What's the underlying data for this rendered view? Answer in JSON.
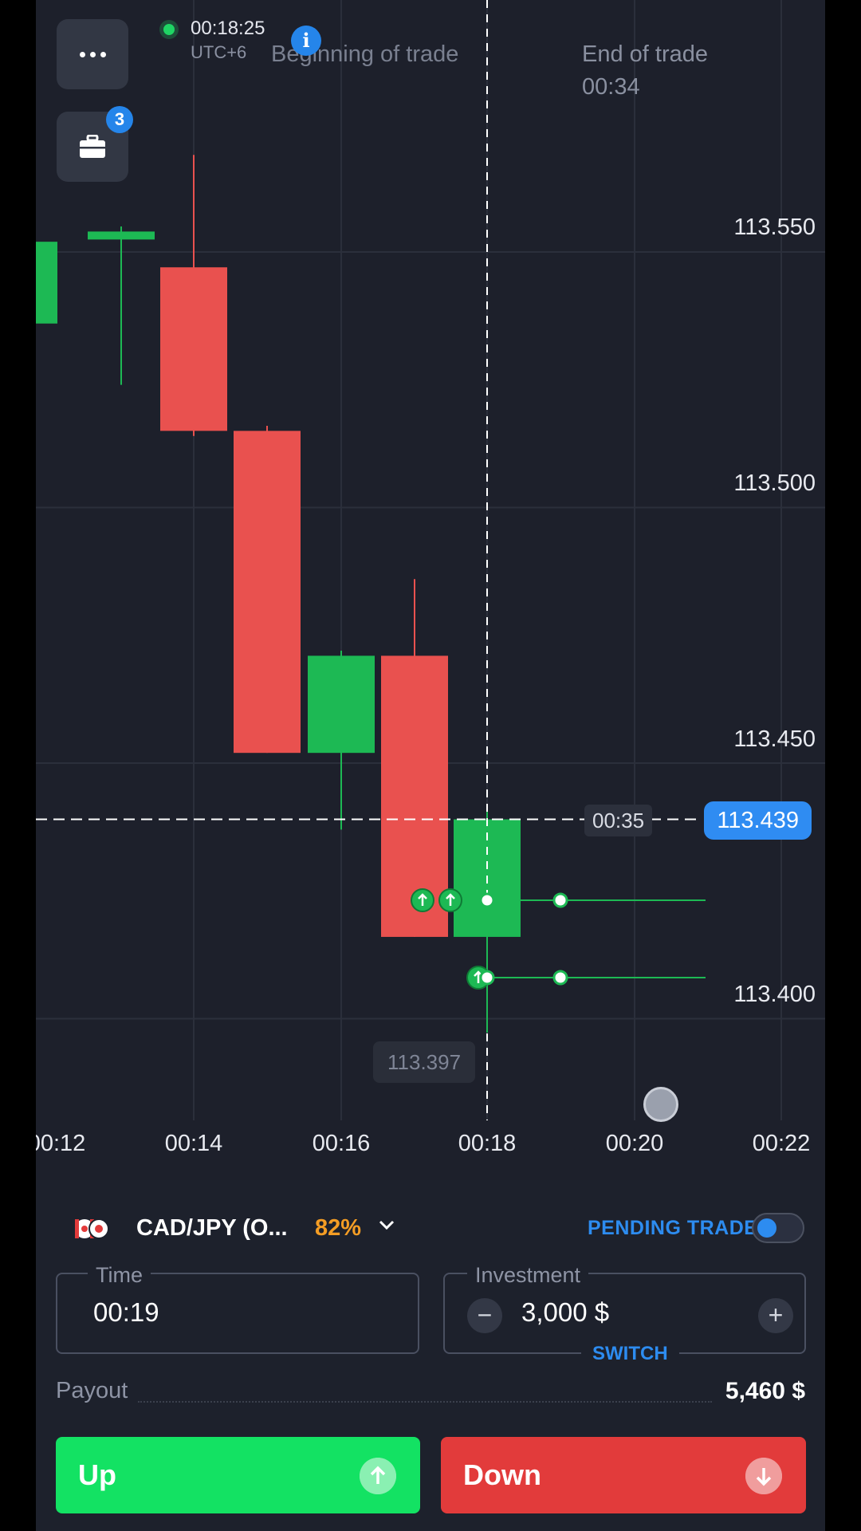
{
  "header": {
    "clock": "00:18:25",
    "timezone": "UTC+6",
    "notification_count": "3",
    "info_glyph": "i",
    "beginning_label": "Beginning of trade",
    "end_label": "End of trade",
    "end_countdown": "00:34"
  },
  "chart": {
    "price_ticks": [
      "113.550",
      "113.500",
      "113.450",
      "113.400"
    ],
    "time_ticks": [
      "00:12",
      "00:14",
      "00:16",
      "00:18",
      "00:20",
      "00:22"
    ],
    "current_price": "113.439",
    "current_countdown": "00:35",
    "low_marker": "113.397",
    "colors": {
      "up": "#1db954",
      "down": "#e9514f",
      "accent": "#2d8cf0"
    }
  },
  "chart_data": {
    "type": "candlestick",
    "candles": [
      {
        "label": "00:12",
        "open": 113.536,
        "high": 113.566,
        "close": 113.552,
        "low": 113.536
      },
      {
        "label": "00:12.30",
        "open": 113.553,
        "high": 113.555,
        "close": 113.554,
        "low": 113.524
      },
      {
        "label": "00:14",
        "open": 113.547,
        "high": 113.569,
        "close": 113.515,
        "low": 113.514
      },
      {
        "label": "00:14.30",
        "open": 113.515,
        "high": 113.516,
        "close": 113.452,
        "low": 113.452
      },
      {
        "label": "00:16",
        "open": 113.452,
        "high": 113.472,
        "close": 113.471,
        "low": 113.437
      },
      {
        "label": "00:16.30",
        "open": 113.471,
        "high": 113.486,
        "close": 113.416,
        "low": 113.416
      },
      {
        "label": "00:18",
        "open": 113.416,
        "high": 113.441,
        "close": 113.439,
        "low": 113.416
      }
    ],
    "y_range": [
      113.36,
      113.58
    ]
  },
  "asset": {
    "name": "CAD/JPY (O...",
    "payout_pct": "82%"
  },
  "pending_label": "PENDING TRADE",
  "time_field": {
    "label": "Time",
    "value": "00:19"
  },
  "investment_field": {
    "label": "Investment",
    "value": "3,000 $",
    "minus": "−",
    "plus": "+",
    "switch_label": "SWITCH"
  },
  "payout": {
    "label": "Payout",
    "value": "5,460 $"
  },
  "actions": {
    "up_label": "Up",
    "down_label": "Down"
  }
}
